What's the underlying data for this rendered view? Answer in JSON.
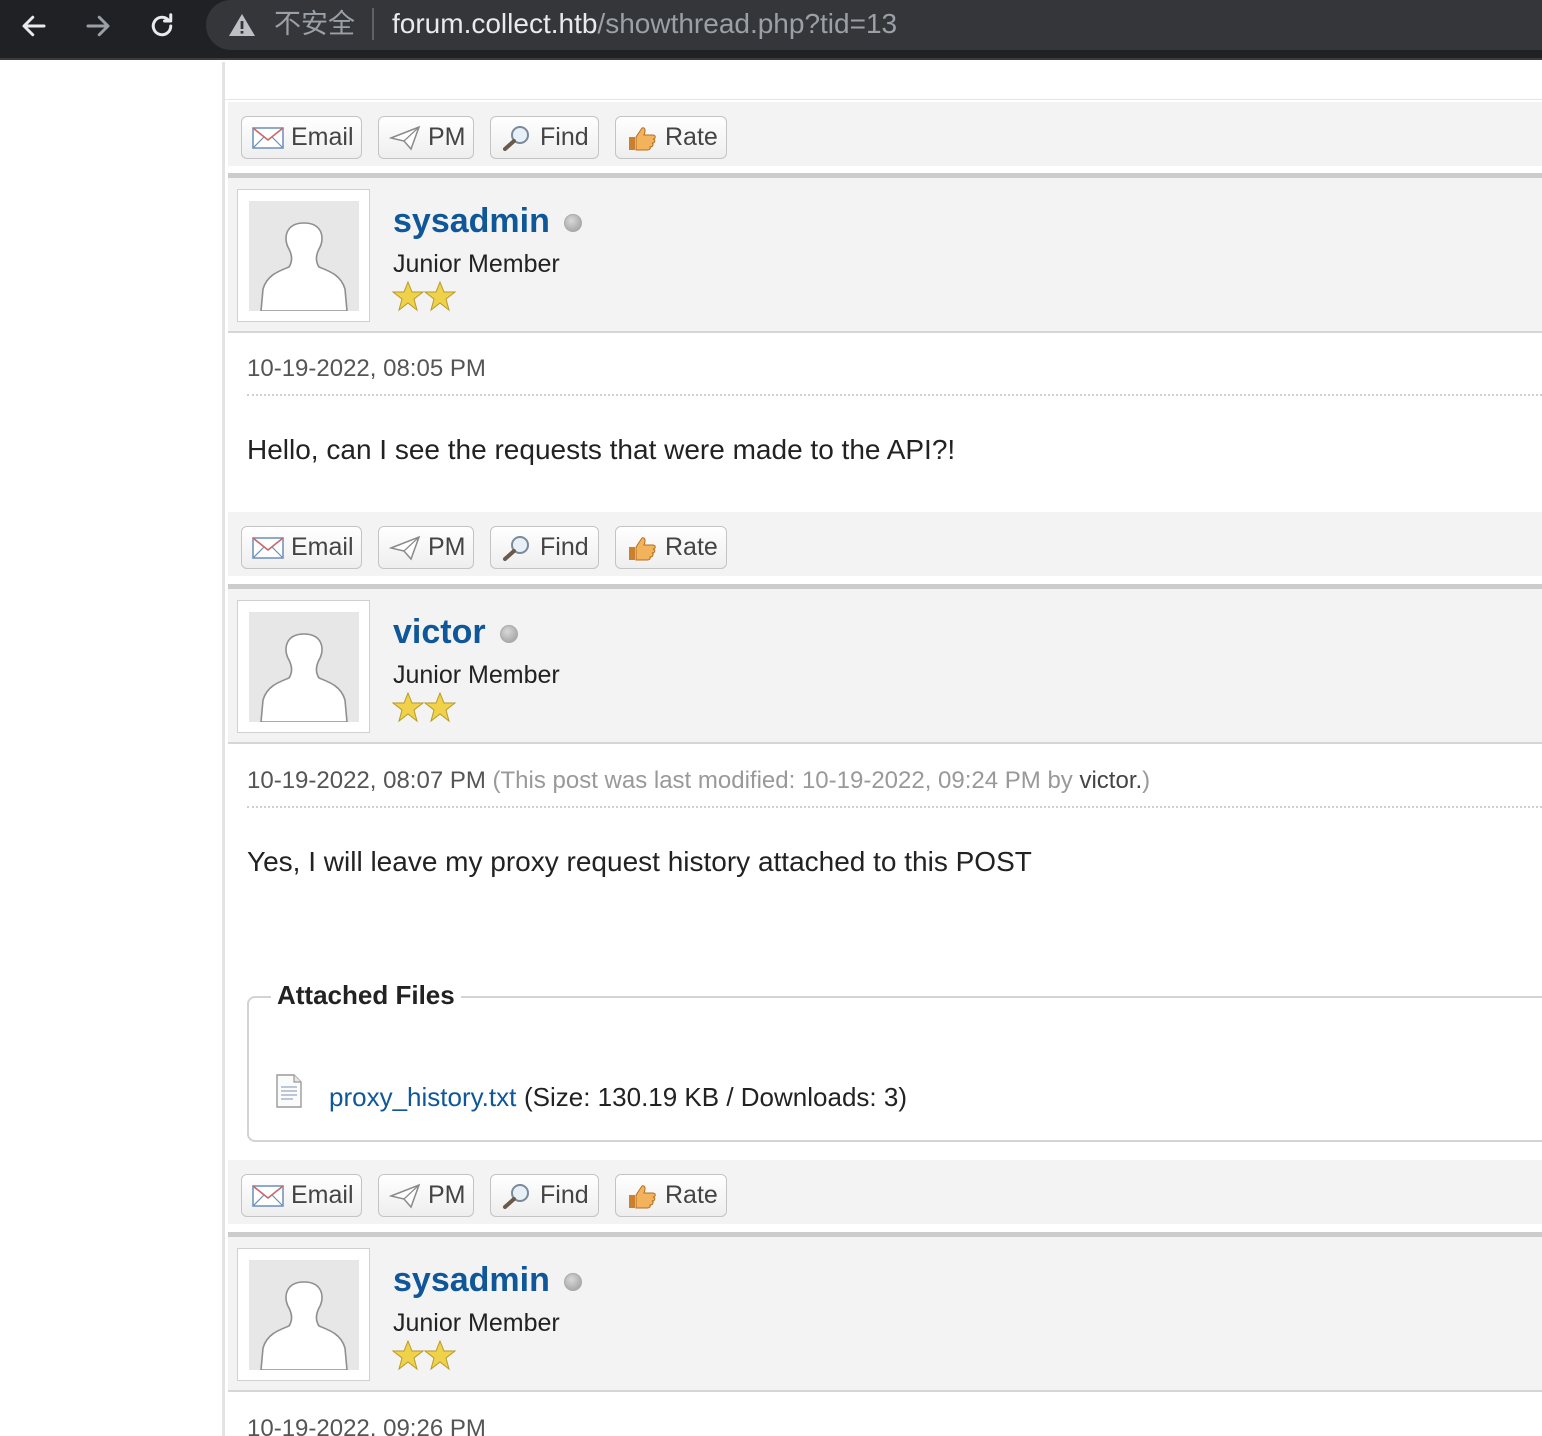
{
  "browser": {
    "security_label": "不安全",
    "url_host": "forum.collect.htb",
    "url_path": "/showthread.php?tid=13"
  },
  "post_buttons": {
    "email": "Email",
    "pm": "PM",
    "find": "Find",
    "rate": "Rate"
  },
  "posts": [
    {
      "username": "sysadmin",
      "user_title": "Junior Member",
      "stars": 2,
      "date": "10-19-2022, 08:05 PM",
      "body": "Hello, can I see the requests that were made to the API?!"
    },
    {
      "username": "victor",
      "user_title": "Junior Member",
      "stars": 2,
      "date": "10-19-2022, 08:07 PM",
      "modified_prefix": "(This post was last modified: 10-19-2022, 09:24 PM by ",
      "modified_user": "victor.",
      "modified_suffix": ")",
      "body": "Yes, I will leave my proxy request history attached to this POST",
      "attachments_title": "Attached Files",
      "attachment": {
        "filename": "proxy_history.txt",
        "info": "(Size: 130.19 KB / Downloads: 3)"
      }
    },
    {
      "username": "sysadmin",
      "user_title": "Junior Member",
      "stars": 2,
      "date": "10-19-2022, 09:26 PM"
    }
  ],
  "colors": {
    "username": "#0f5799",
    "link": "#0f5799",
    "browser_bg": "#202124"
  }
}
